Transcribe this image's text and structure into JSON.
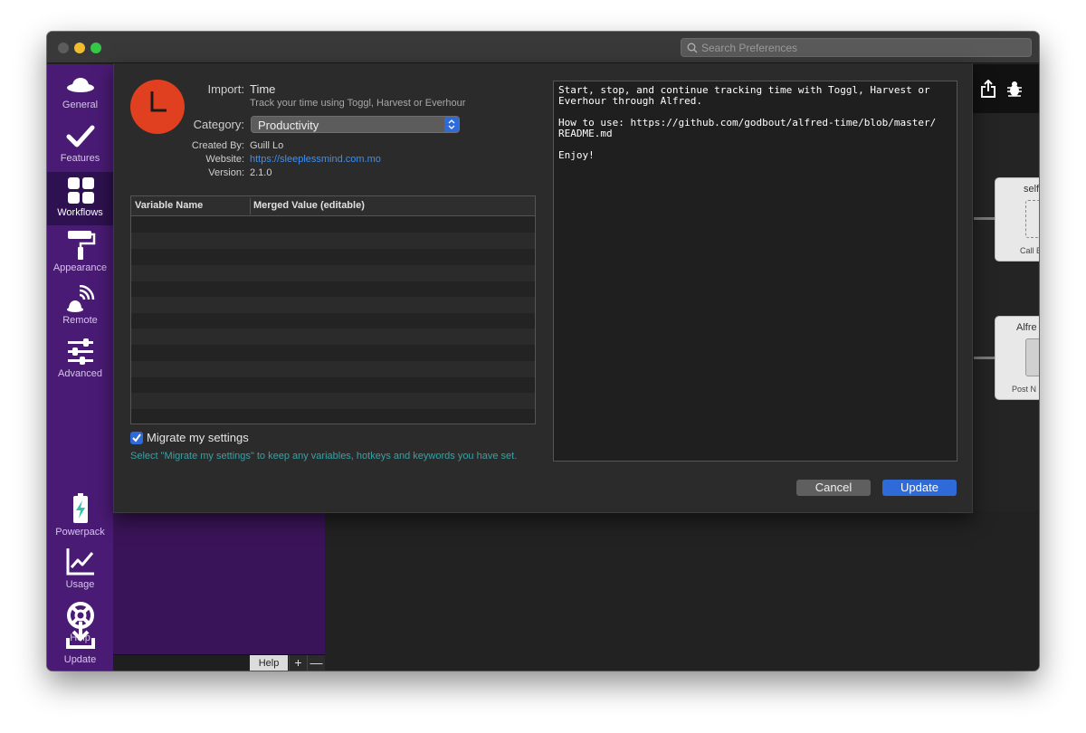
{
  "titlebar": {
    "search_placeholder": "Search Preferences"
  },
  "sidebar": {
    "items": [
      {
        "label": "General",
        "icon": "hat-icon"
      },
      {
        "label": "Features",
        "icon": "checkmark-icon"
      },
      {
        "label": "Workflows",
        "icon": "grid-icon",
        "active": true
      },
      {
        "label": "Appearance",
        "icon": "paint-roller-icon"
      },
      {
        "label": "Remote",
        "icon": "remote-signal-icon"
      },
      {
        "label": "Advanced",
        "icon": "sliders-icon"
      },
      {
        "label": "Powerpack",
        "icon": "battery-bolt-icon"
      },
      {
        "label": "Usage",
        "icon": "chart-line-icon"
      },
      {
        "label": "Help",
        "icon": "lifebuoy-icon"
      },
      {
        "label": "Update",
        "icon": "download-icon"
      }
    ]
  },
  "workflow_bar": {
    "help": "Help",
    "add": "+",
    "remove": "—"
  },
  "canvas": {
    "nodes": [
      {
        "title": "self",
        "subtitle": "Call E"
      },
      {
        "title": "Alfre",
        "subtitle": "Post N"
      }
    ]
  },
  "import_dialog": {
    "import_label": "Import:",
    "name": "Time",
    "description": "Track your time using Toggl, Harvest or Everhour",
    "category_label": "Category:",
    "category_value": "Productivity",
    "created_by_label": "Created By:",
    "created_by": "Guill Lo",
    "website_label": "Website:",
    "website": "https://sleeplessmind.com.mo",
    "version_label": "Version:",
    "version": "2.1.0",
    "table": {
      "columns": [
        "Variable Name",
        "Merged Value (editable)"
      ],
      "rows": []
    },
    "migrate_label": "Migrate my settings",
    "migrate_checked": true,
    "migrate_hint": "Select \"Migrate my settings\" to keep any variables, hotkeys and keywords you have set.",
    "readme_text": "Start, stop, and continue tracking time with Toggl, Harvest or\nEverhour through Alfred.\n\nHow to use: https://github.com/godbout/alfred-time/blob/master/\nREADME.md\n\nEnjoy!",
    "cancel_label": "Cancel",
    "update_label": "Update"
  },
  "colors": {
    "sidebar": "#4a1b75",
    "accent_blue": "#2f6ad9",
    "icon_orange": "#e0401f",
    "hint_teal": "#3aa0a3",
    "link_blue": "#3d8ff0"
  }
}
